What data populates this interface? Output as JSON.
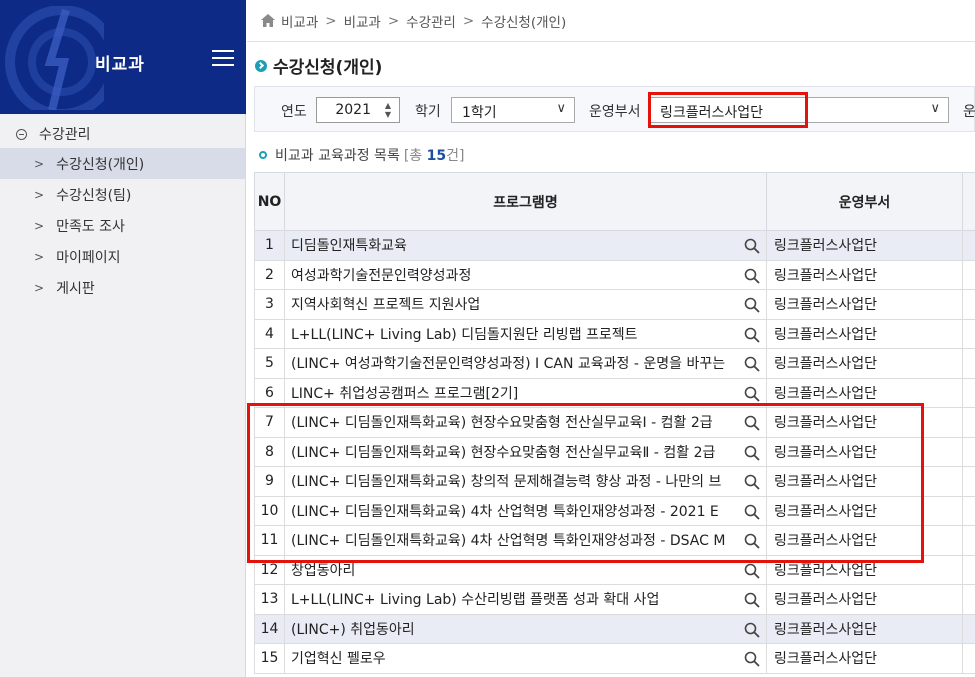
{
  "sidebar": {
    "title": "비교과",
    "group_label": "수강관리",
    "items": [
      {
        "label": "수강신청(개인)",
        "active": true
      },
      {
        "label": "수강신청(팀)",
        "active": false
      },
      {
        "label": "만족도 조사",
        "active": false
      },
      {
        "label": "마이페이지",
        "active": false
      },
      {
        "label": "게시판",
        "active": false
      }
    ]
  },
  "breadcrumb": [
    "비교과",
    "비교과",
    "수강관리",
    "수강신청(개인)"
  ],
  "page_title": "수강신청(개인)",
  "filters": {
    "year_label": "연도",
    "year_value": "2021",
    "semester_label": "학기",
    "semester_value": "1학기",
    "dept_label": "운영부서",
    "dept_value": "링크플러스사업단",
    "next_label_partial": "운"
  },
  "list": {
    "title": "비교과 교육과정 목록",
    "count_prefix": "[총 ",
    "count": "15",
    "count_suffix": "건]"
  },
  "table": {
    "headers": [
      "NO",
      "프로그램명",
      "운영부서"
    ],
    "rows": [
      {
        "no": "1",
        "program": "디딤돌인재특화교육",
        "dept": "링크플러스사업단"
      },
      {
        "no": "2",
        "program": "여성과학기술전문인력양성과정",
        "dept": "링크플러스사업단"
      },
      {
        "no": "3",
        "program": "지역사회혁신 프로젝트 지원사업",
        "dept": "링크플러스사업단"
      },
      {
        "no": "4",
        "program": "L+LL(LINC+ Living Lab) 디딤돌지원단 리빙랩 프로젝트",
        "dept": "링크플러스사업단"
      },
      {
        "no": "5",
        "program": "(LINC+ 여성과학기술전문인력양성과정) I CAN 교육과정 - 운명을 바꾸는",
        "dept": "링크플러스사업단"
      },
      {
        "no": "6",
        "program": "LINC+ 취업성공캠퍼스 프로그램[2기]",
        "dept": "링크플러스사업단"
      },
      {
        "no": "7",
        "program": "(LINC+ 디딤돌인재특화교육) 현장수요맞춤형 전산실무교육Ⅰ - 컴활 2급",
        "dept": "링크플러스사업단"
      },
      {
        "no": "8",
        "program": "(LINC+ 디딤돌인재특화교육) 현장수요맞춤형 전산실무교육Ⅱ - 컴활 2급",
        "dept": "링크플러스사업단"
      },
      {
        "no": "9",
        "program": "(LINC+ 디딤돌인재특화교육) 창의적 문제해결능력 향상 과정 - 나만의 브",
        "dept": "링크플러스사업단"
      },
      {
        "no": "10",
        "program": "(LINC+ 디딤돌인재특화교육) 4차 산업혁명 특화인재양성과정 - 2021 E",
        "dept": "링크플러스사업단"
      },
      {
        "no": "11",
        "program": "(LINC+ 디딤돌인재특화교육) 4차 산업혁명 특화인재양성과정 - DSAC M",
        "dept": "링크플러스사업단"
      },
      {
        "no": "12",
        "program": "창업동아리",
        "dept": "링크플러스사업단"
      },
      {
        "no": "13",
        "program": "L+LL(LINC+ Living Lab) 수산리빙랩 플랫폼 성과 확대 사업",
        "dept": "링크플러스사업단"
      },
      {
        "no": "14",
        "program": "(LINC+) 취업동아리",
        "dept": "링크플러스사업단"
      },
      {
        "no": "15",
        "program": "기업혁신 펠로우",
        "dept": "링크플러스사업단"
      }
    ],
    "selected_rows": [
      "1",
      "14"
    ]
  },
  "colors": {
    "sidebar_header": "#0d2a86",
    "accent": "#1c9fb5",
    "highlight": "#e3120b"
  }
}
